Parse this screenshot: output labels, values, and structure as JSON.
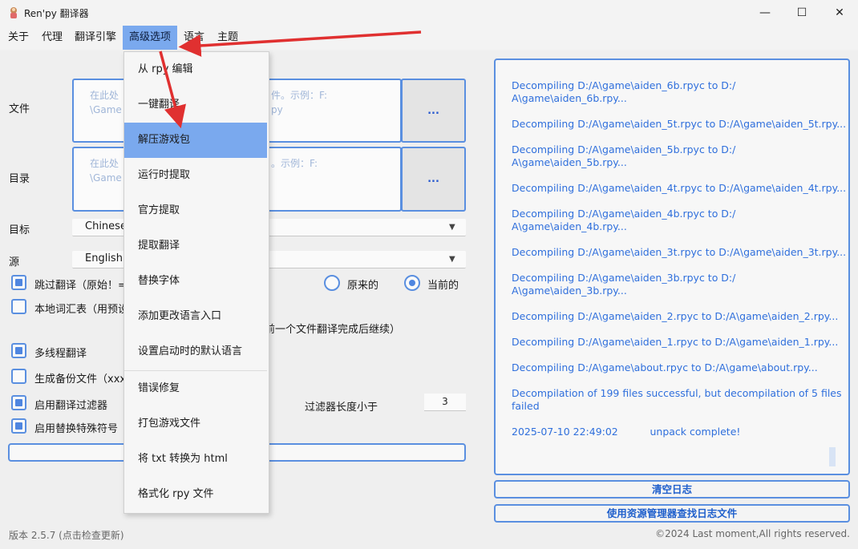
{
  "window": {
    "title": "Ren'py 翻译器",
    "controls": {
      "minimize": "—",
      "maximize": "☐",
      "close": "✕"
    }
  },
  "menubar": [
    "关于",
    "代理",
    "翻译引擎",
    "高级选项",
    "语言",
    "主题"
  ],
  "form": {
    "file_label": "文件",
    "file_placeholder_left": "在此处\n\\Game",
    "file_placeholder_right": "件。示例：F:\npy",
    "dir_label": "目录",
    "dir_placeholder_left": "在此处\n\\Game",
    "dir_placeholder_right": "。示例：F:",
    "browse": "...",
    "target_label": "目标",
    "target_value": "Chinese",
    "source_label": "源",
    "source_value": "English",
    "skip_translate": "跳过翻译（原始！=",
    "radio_original": "原来的",
    "radio_current": "当前的",
    "local_glossary": "本地词汇表（用预设",
    "wait_note": "前一个文件翻译完成后继续）",
    "multithread": "多线程翻译",
    "backup": "生成备份文件（xxx",
    "filter_enable": "启用翻译过滤器",
    "filter_length_label": "过滤器长度小于",
    "filter_length_value": "3",
    "replace_special": "启用替换特殊符号"
  },
  "dropdown": [
    "从 rpy 编辑",
    "一键翻译",
    "解压游戏包",
    "运行时提取",
    "官方提取",
    "提取翻译",
    "替换字体",
    "添加更改语言入口",
    "设置启动时的默认语言",
    "错误修复",
    "打包游戏文件",
    "将 txt 转换为 html",
    "格式化 rpy 文件"
  ],
  "log": [
    "Decompiling D:/A\\game\\aiden_6b.rpyc to D:/\nA\\game\\aiden_6b.rpy...",
    "Decompiling D:/A\\game\\aiden_5t.rpyc to D:/A\\game\\aiden_5t.rpy...",
    "Decompiling D:/A\\game\\aiden_5b.rpyc to D:/\nA\\game\\aiden_5b.rpy...",
    "Decompiling D:/A\\game\\aiden_4t.rpyc to D:/A\\game\\aiden_4t.rpy...",
    "Decompiling D:/A\\game\\aiden_4b.rpyc to D:/\nA\\game\\aiden_4b.rpy...",
    "Decompiling D:/A\\game\\aiden_3t.rpyc to D:/A\\game\\aiden_3t.rpy...",
    "Decompiling D:/A\\game\\aiden_3b.rpyc to D:/\nA\\game\\aiden_3b.rpy...",
    "Decompiling D:/A\\game\\aiden_2.rpyc to D:/A\\game\\aiden_2.rpy...",
    "Decompiling D:/A\\game\\aiden_1.rpyc to D:/A\\game\\aiden_1.rpy...",
    "Decompiling D:/A\\game\\about.rpyc to D:/A\\game\\about.rpy...",
    "Decompilation of 199 files successful, but decompilation of 5 files\nfailed",
    "2025-07-10 22:49:02          unpack complete!"
  ],
  "buttons": {
    "clear_log": "清空日志",
    "open_log": "使用资源管理器查找日志文件"
  },
  "footer": {
    "version": "版本 2.5.7 (点击检查更新)",
    "copyright": "©2024 Last moment,All rights reserved."
  },
  "colors": {
    "accent": "#5a8fe0",
    "highlight": "#7aa9ee",
    "log_text": "#2f6fdc",
    "arrow": "#e03030"
  }
}
